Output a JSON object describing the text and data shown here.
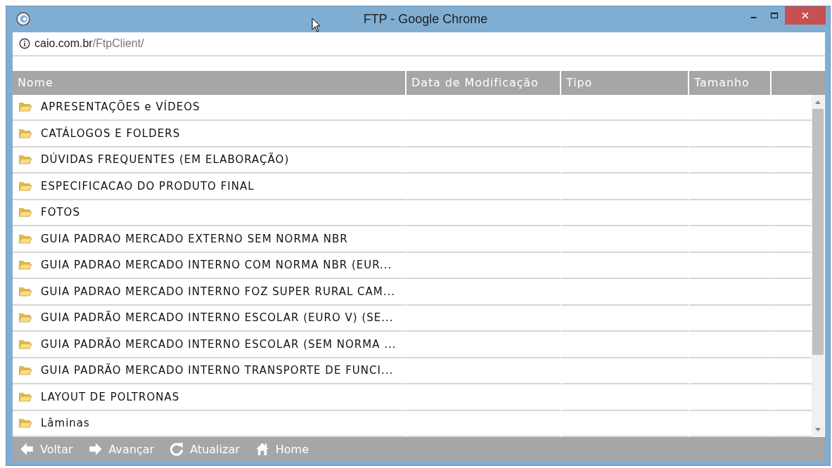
{
  "window": {
    "title": "FTP - Google Chrome"
  },
  "address": {
    "host": "caio.com.br",
    "path": "/FtpClient/"
  },
  "table": {
    "columns": [
      "Nome",
      "Data de Modificação",
      "Tipo",
      "Tamanho"
    ],
    "rows": [
      {
        "name": "APRESENTAÇÕES e VÍDEOS"
      },
      {
        "name": "CATÁLOGOS E FOLDERS"
      },
      {
        "name": "DÚVIDAS FREQUENTES (EM ELABORAÇÃO)"
      },
      {
        "name": "ESPECIFICACAO DO PRODUTO FINAL"
      },
      {
        "name": "FOTOS"
      },
      {
        "name": "GUIA PADRAO MERCADO EXTERNO SEM NORMA NBR"
      },
      {
        "name": "GUIA PADRAO MERCADO INTERNO COM NORMA NBR (EUR..."
      },
      {
        "name": "GUIA PADRAO MERCADO INTERNO FOZ SUPER RURAL CAM..."
      },
      {
        "name": "GUIA PADRÃO MERCADO INTERNO ESCOLAR (EURO V) (SE..."
      },
      {
        "name": "GUIA PADRÃO MERCADO INTERNO ESCOLAR (SEM NORMA ..."
      },
      {
        "name": "GUIA PADRÃO MERCADO INTERNO TRANSPORTE DE FUNCI..."
      },
      {
        "name": "LAYOUT DE POLTRONAS"
      },
      {
        "name": "Lâminas"
      }
    ]
  },
  "toolbar": [
    {
      "label": "Voltar",
      "kind": "back"
    },
    {
      "label": "Avançar",
      "kind": "forward"
    },
    {
      "label": "Atualizar",
      "kind": "refresh"
    },
    {
      "label": "Home",
      "kind": "home"
    }
  ]
}
